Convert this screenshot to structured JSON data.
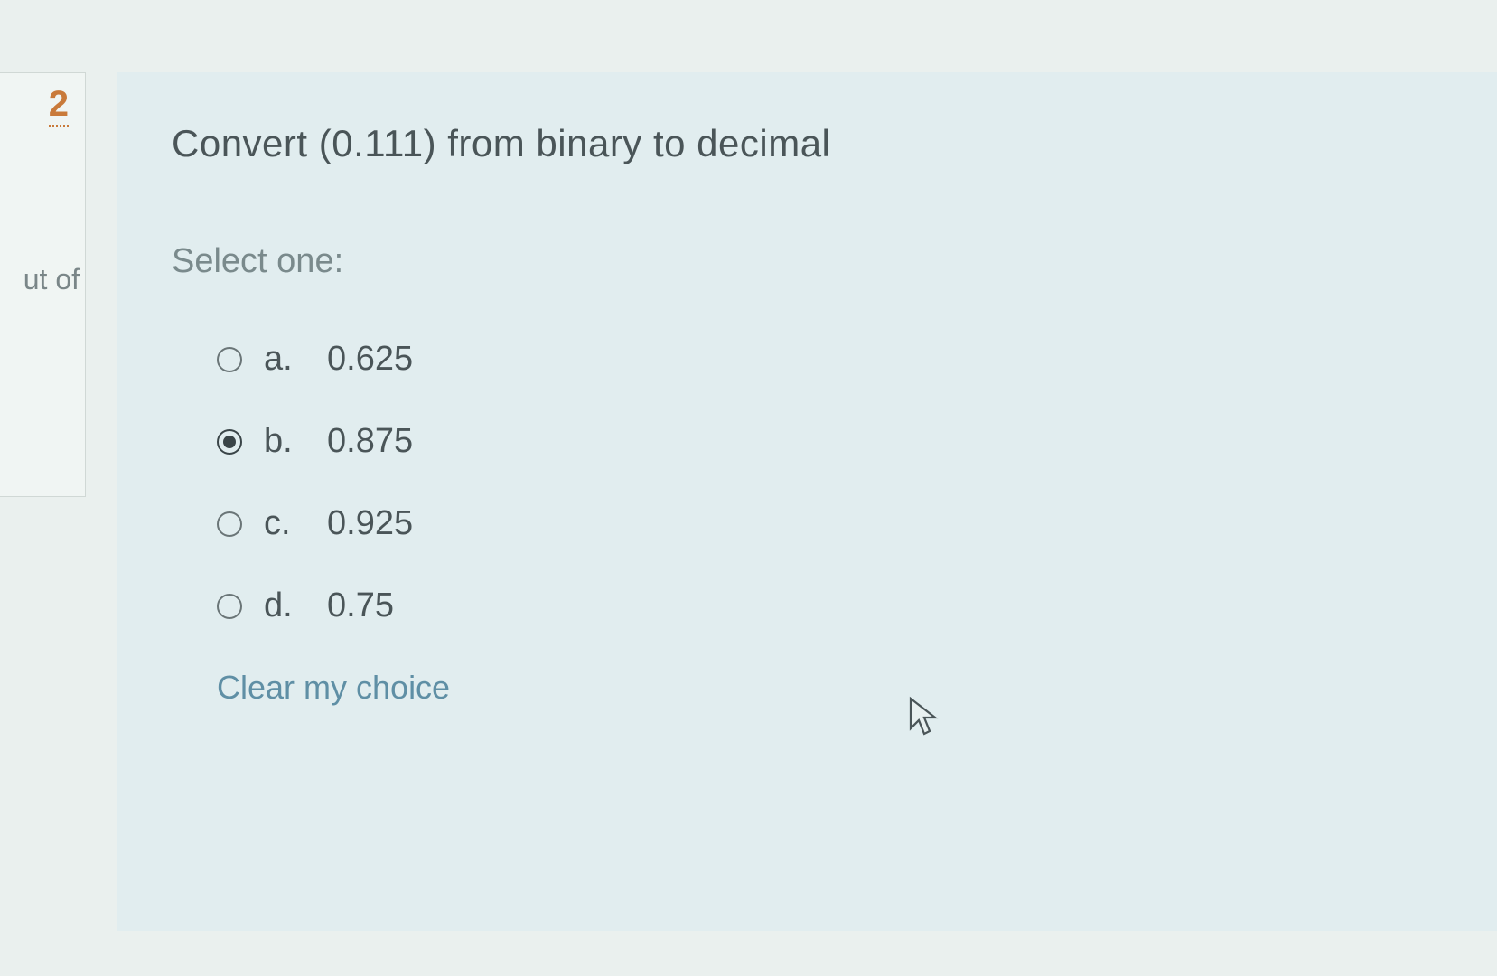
{
  "sidebar": {
    "number": "2",
    "marks_label_fragment": "ut of"
  },
  "question": {
    "text": "Convert (0.111) from binary to decimal",
    "prompt": "Select one:",
    "options": [
      {
        "letter": "a.",
        "value": "0.625",
        "selected": false
      },
      {
        "letter": "b.",
        "value": "0.875",
        "selected": true
      },
      {
        "letter": "c.",
        "value": "0.925",
        "selected": false
      },
      {
        "letter": "d.",
        "value": "0.75",
        "selected": false
      }
    ],
    "clear_label": "Clear my choice"
  }
}
